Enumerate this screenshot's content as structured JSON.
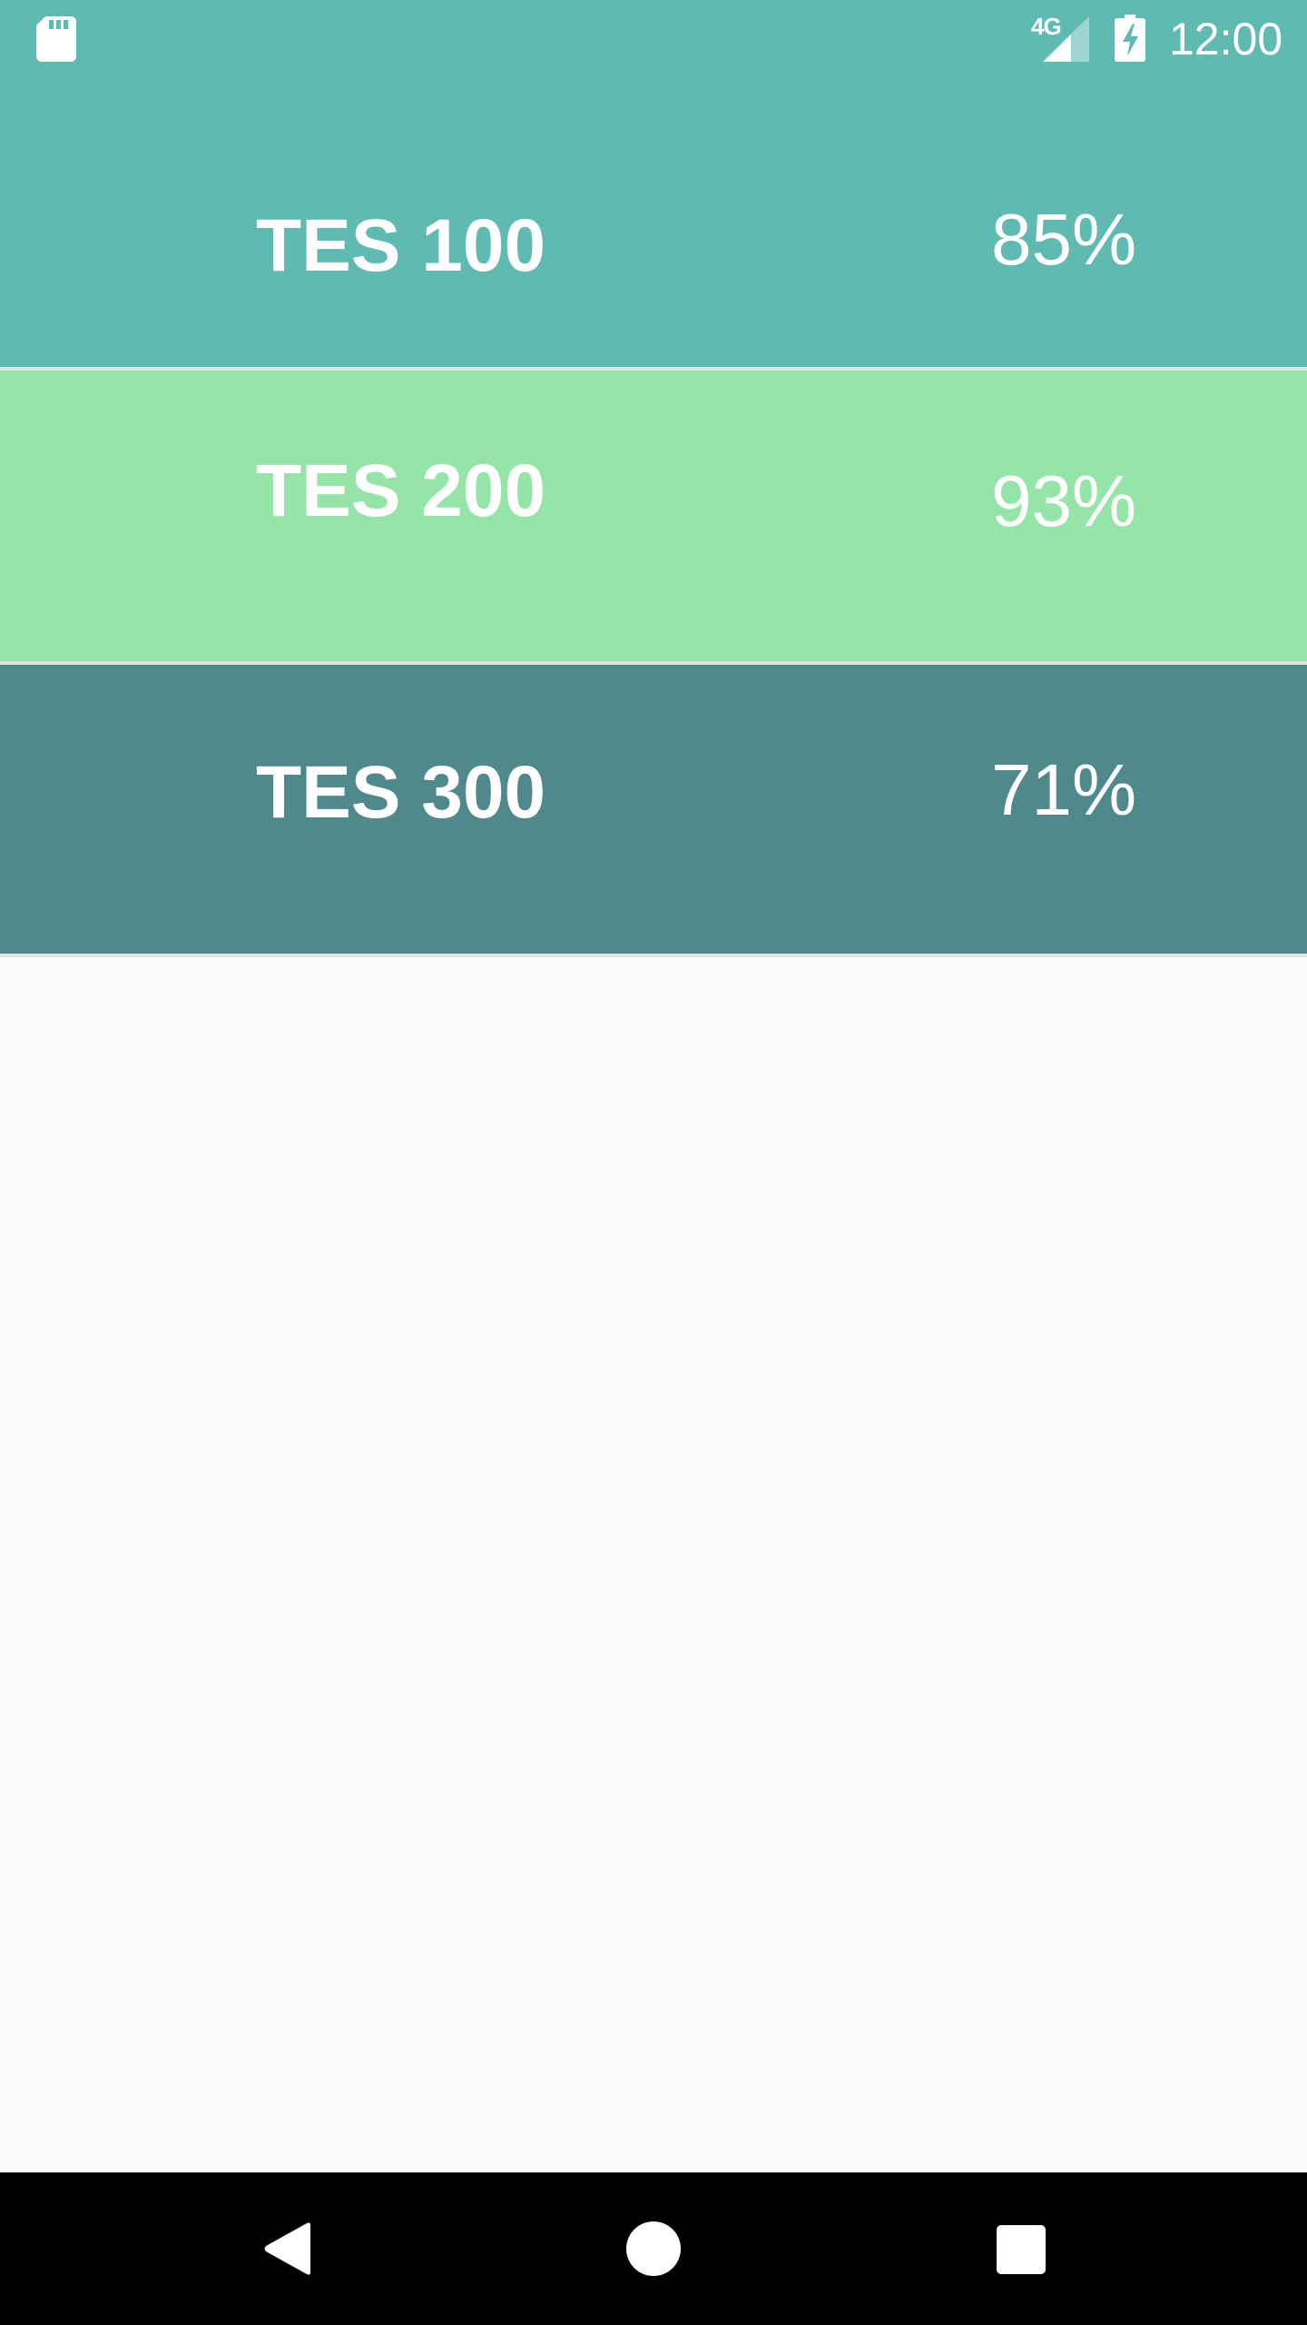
{
  "status_bar": {
    "network": "4G",
    "time": "12:00",
    "icons": [
      "sd-card-icon",
      "signal-icon",
      "battery-charging-icon"
    ]
  },
  "colors": {
    "row_1": "#5fbab1",
    "row_2": "#96e5a8",
    "row_3": "#50898b",
    "background": "#fafafa"
  },
  "list": {
    "items": [
      {
        "name": "TES 100",
        "value": "85%"
      },
      {
        "name": "TES 200",
        "value": "93%"
      },
      {
        "name": "TES 300",
        "value": "71%"
      }
    ]
  },
  "nav_bar": {
    "icons": [
      "back-icon",
      "home-icon",
      "recents-icon"
    ]
  }
}
